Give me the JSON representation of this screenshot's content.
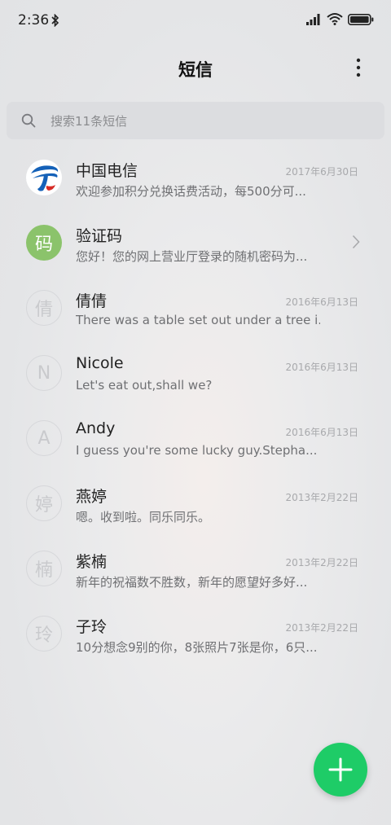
{
  "status_bar": {
    "time": "2:36",
    "icons": [
      "bluetooth-icon",
      "signal-icon",
      "wifi-icon",
      "battery-icon"
    ]
  },
  "app_bar": {
    "title": "短信",
    "menu_icon": "more-vert-icon"
  },
  "search": {
    "placeholder": "搜索11条短信",
    "icon": "search-icon"
  },
  "conversations": [
    {
      "name": "中国电信",
      "date": "2017年6月30日",
      "preview": "欢迎参加积分兑换话费活动，每500分可...",
      "avatar": "telecom-logo"
    },
    {
      "name": "验证码",
      "date": "",
      "preview": "您好！您的网上营业厅登录的随机密码为...",
      "avatar_text": "码",
      "avatar_color": "#8bc36b"
    },
    {
      "name": "倩倩",
      "date": "2016年6月13日",
      "preview": "There was a table set out under a tree i...",
      "avatar_text": "倩"
    },
    {
      "name": "Nicole",
      "date": "2016年6月13日",
      "preview": "Let's eat out,shall we?",
      "avatar_text": "N"
    },
    {
      "name": "Andy",
      "date": "2016年6月13日",
      "preview": "I guess you're some lucky guy.Stepha...",
      "avatar_text": "A"
    },
    {
      "name": "燕婷",
      "date": "2013年2月22日",
      "preview": "嗯。收到啦。同乐同乐。",
      "avatar_text": "婷"
    },
    {
      "name": "紫楠",
      "date": "2013年2月22日",
      "preview": "新年的祝福数不胜数，新年的愿望好多好...",
      "avatar_text": "楠"
    },
    {
      "name": "子玲",
      "date": "2013年2月22日",
      "preview": "10分想念9别的你，8张照片7张是你，6只...",
      "avatar_text": "玲"
    }
  ],
  "fab": {
    "icon": "plus-icon",
    "color": "#1ecc67"
  }
}
